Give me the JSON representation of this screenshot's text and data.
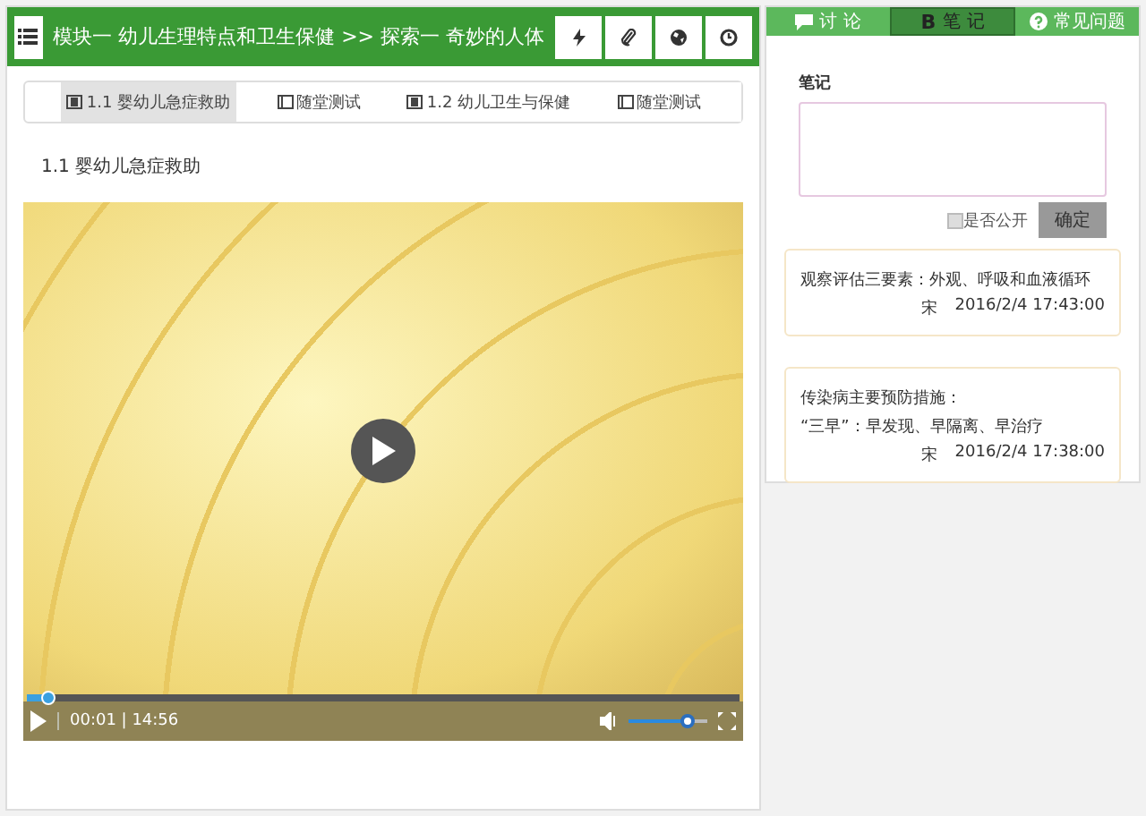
{
  "header": {
    "title": "模块一 幼儿生理特点和卫生保健 >> 探索一 奇妙的人体"
  },
  "lesson_tabs": [
    {
      "label": "1.1 婴幼儿急症救助",
      "kind": "video",
      "selected": true
    },
    {
      "label": "随堂测试",
      "kind": "quiz",
      "selected": false
    },
    {
      "label": "1.2 幼儿卫生与保健",
      "kind": "video",
      "selected": false
    },
    {
      "label": "随堂测试",
      "kind": "quiz",
      "selected": false
    }
  ],
  "section_title": "1.1 婴幼儿急症救助",
  "player": {
    "time": "00:01 | 14:56",
    "progress": {
      "level": 0.03
    },
    "volume": {
      "level": 0.75
    }
  },
  "side_tabs": [
    {
      "label": "讨 论",
      "kind": "chat",
      "selected": false
    },
    {
      "label": "笔 记",
      "kind": "bold",
      "icon": "B",
      "selected": true
    },
    {
      "label": "常见问题",
      "kind": "help",
      "selected": false
    }
  ],
  "note_form": {
    "label": "笔记",
    "public_label": "是否公开",
    "public_checked": false,
    "submit": "确定"
  },
  "notes": [
    {
      "lines": [
        "观察评估三要素：外观、呼吸和血液循环"
      ],
      "author": "宋",
      "time": "2016/2/4 17:43:00"
    },
    {
      "lines": [
        "传染病主要预防措施：",
        "“三早”：早发现、早隔离、早治疗"
      ],
      "author": "宋",
      "time": "2016/2/4 17:38:00"
    }
  ]
}
